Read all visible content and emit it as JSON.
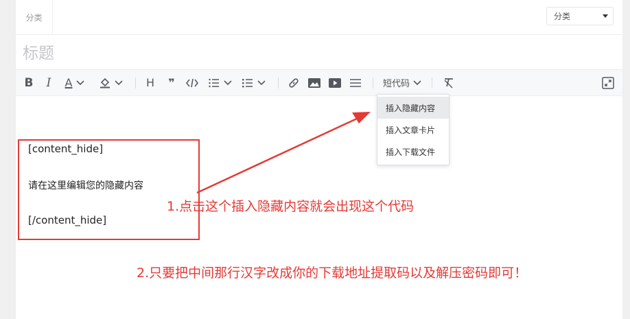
{
  "category": {
    "label": "分类",
    "select_value": "分类"
  },
  "title": {
    "placeholder": "标题"
  },
  "toolbar": {
    "icons": [
      {
        "name": "bold-icon",
        "glyph": "B"
      },
      {
        "name": "italic-icon",
        "glyph": "I"
      },
      {
        "name": "font-color-icon",
        "glyph": "A"
      },
      {
        "name": "highlight-color-icon",
        "glyph": ""
      },
      {
        "name": "heading-icon",
        "glyph": "H"
      },
      {
        "name": "quote-icon",
        "glyph": "❞"
      },
      {
        "name": "code-icon",
        "glyph": "</>"
      },
      {
        "name": "ordered-list-icon",
        "glyph": ""
      },
      {
        "name": "unordered-list-icon",
        "glyph": ""
      },
      {
        "name": "link-icon",
        "glyph": ""
      },
      {
        "name": "image-icon",
        "glyph": ""
      },
      {
        "name": "video-icon",
        "glyph": ""
      },
      {
        "name": "divider-icon",
        "glyph": ""
      },
      {
        "name": "clear-format-icon",
        "glyph": ""
      },
      {
        "name": "fullscreen-icon",
        "glyph": ""
      }
    ],
    "shortcode_label": "短代码"
  },
  "dropdown": {
    "items": [
      {
        "label": "插入隐藏内容",
        "active": true
      },
      {
        "label": "插入文章卡片",
        "active": false
      },
      {
        "label": "插入下载文件",
        "active": false
      }
    ]
  },
  "editor": {
    "lines": [
      "[content_hide]",
      "请在这里编辑您的隐藏内容",
      "[/content_hide]"
    ]
  },
  "annotations": {
    "note1": "1.点击这个插入隐藏内容就会出现这个代码",
    "note2": "2.只要把中间那行汉字改成你的下载地址提取码以及解压密码即可！",
    "color": "#e53935"
  }
}
